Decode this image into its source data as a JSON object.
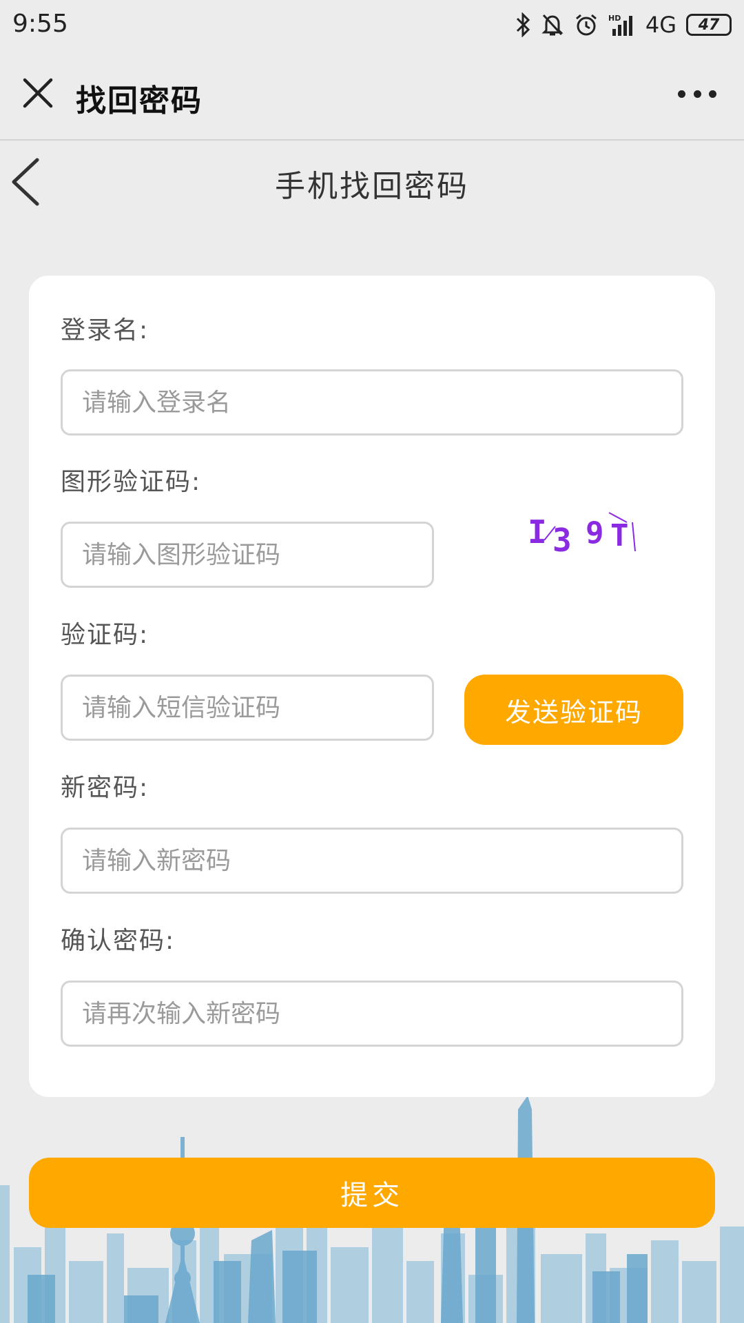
{
  "status_bar": {
    "time": "9:55",
    "network": "4G",
    "battery": "47",
    "icons": [
      "bluetooth-icon",
      "bell-off-icon",
      "alarm-icon",
      "hd-signal-icon"
    ]
  },
  "app_bar": {
    "title": "找回密码",
    "close_icon": "close-icon",
    "more_icon": "more-icon"
  },
  "page": {
    "title": "手机找回密码",
    "back_icon": "chevron-left-icon"
  },
  "form": {
    "username": {
      "label": "登录名:",
      "placeholder": "请输入登录名",
      "value": ""
    },
    "image_captcha": {
      "label": "图形验证码:",
      "placeholder": "请输入图形验证码",
      "value": "",
      "captcha_text": "1 3 9 T"
    },
    "sms_code": {
      "label": "验证码:",
      "placeholder": "请输入短信验证码",
      "value": "",
      "send_button": "发送验证码"
    },
    "new_password": {
      "label": "新密码:",
      "placeholder": "请输入新密码",
      "value": ""
    },
    "confirm_password": {
      "label": "确认密码:",
      "placeholder": "请再次输入新密码",
      "value": ""
    }
  },
  "submit_label": "提交",
  "colors": {
    "accent": "#ffa800",
    "background": "#ececec",
    "card": "#ffffff",
    "captcha_text": "#8a2be2",
    "skyline": "#7fb6d6"
  }
}
